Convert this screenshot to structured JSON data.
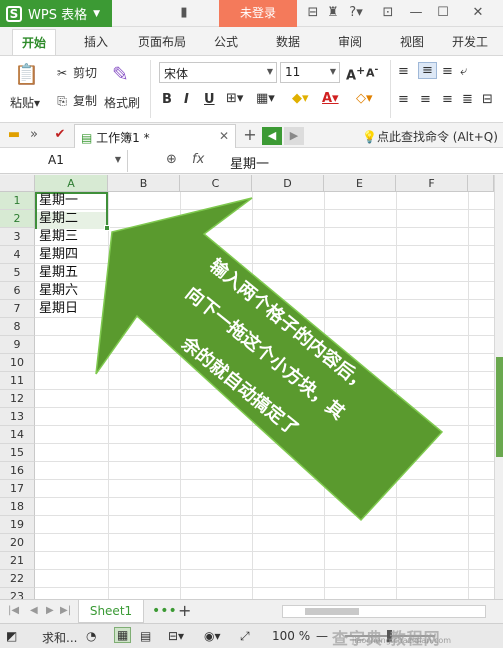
{
  "titlebar": {
    "app_name": "WPS 表格",
    "login_label": "未登录",
    "help_label": "?"
  },
  "ribbon_tabs": [
    "开始",
    "插入",
    "页面布局",
    "公式",
    "数据",
    "审阅",
    "视图",
    "开发工"
  ],
  "ribbon": {
    "paste_label": "粘贴",
    "cut_label": "剪切",
    "copy_label": "复制",
    "format_painter_label": "格式刷",
    "font_name": "宋体",
    "font_size": "11",
    "bold": "B",
    "italic": "I",
    "underline": "U"
  },
  "doc_row": {
    "doc_tab_label": "工作簿1 *",
    "search_hint": "点此查找命令 (Alt+Q)"
  },
  "formula_bar": {
    "cell_ref": "A1",
    "fx_label": "fx",
    "content": "星期一"
  },
  "grid": {
    "columns": [
      "A",
      "B",
      "C",
      "D",
      "E",
      "F"
    ],
    "row_numbers": [
      "1",
      "2",
      "3",
      "4",
      "5",
      "6",
      "7",
      "8",
      "9",
      "10",
      "11",
      "12",
      "13",
      "14",
      "15",
      "16",
      "17",
      "18",
      "19",
      "20",
      "21",
      "22",
      "23"
    ],
    "column_a_values": [
      "星期一",
      "星期二",
      "星期三",
      "星期四",
      "星期五",
      "星期六",
      "星期日"
    ]
  },
  "annotation": {
    "lines": [
      "输入两个格子的内容后，",
      "向下一拖这个小方块，其",
      "余的就自动搞定了"
    ],
    "arrow_color": "#5a9a2e"
  },
  "sheetbar": {
    "sheet_name": "Sheet1",
    "add_label": "+"
  },
  "statusbar": {
    "sum_label": "求和...",
    "zoom_label": "100 %",
    "watermark": "查字典 教程网",
    "watermark_sub": "jiaocheng.chazidian.com"
  },
  "colors": {
    "accent_green": "#3c9a34",
    "login_orange": "#f47a5b"
  }
}
